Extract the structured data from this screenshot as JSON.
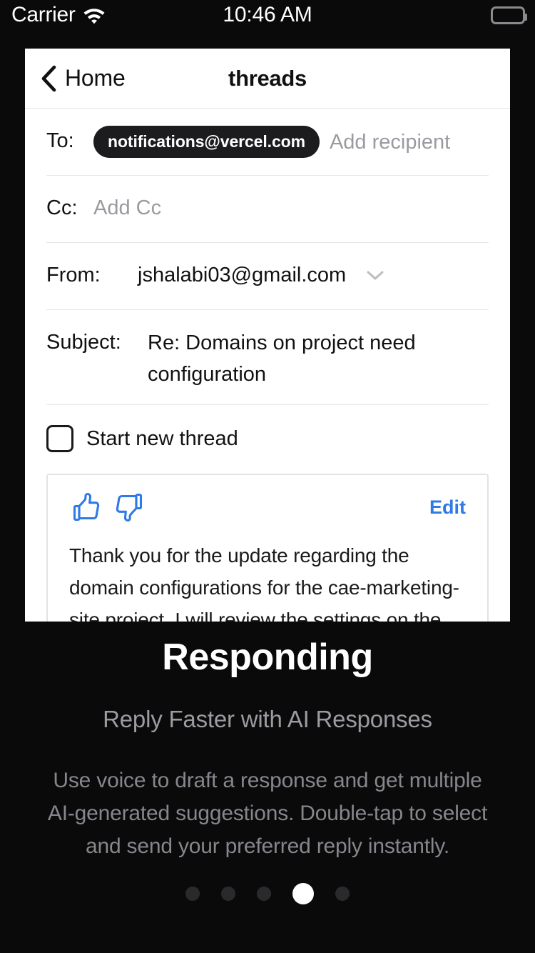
{
  "status_bar": {
    "carrier": "Carrier",
    "wifi_icon": "wifi-icon",
    "time": "10:46 AM",
    "battery_icon": "battery-full-icon"
  },
  "preview": {
    "nav": {
      "back_icon": "chevron-left-icon",
      "back_label": "Home",
      "title": "threads"
    },
    "compose": {
      "to": {
        "label": "To:",
        "chips": [
          "notifications@vercel.com"
        ],
        "placeholder": "Add recipient"
      },
      "cc": {
        "label": "Cc:",
        "placeholder": "Add Cc"
      },
      "from": {
        "label": "From:",
        "value": "jshalabi03@gmail.com",
        "dropdown_icon": "chevron-down-icon"
      },
      "subject": {
        "label": "Subject:",
        "value": "Re: Domains on project need configuration"
      },
      "start_new_thread": {
        "label": "Start new thread",
        "checked": false
      }
    },
    "suggestion": {
      "thumbs_up_icon": "thumbs-up-icon",
      "thumbs_down_icon": "thumbs-down-icon",
      "edit_label": "Edit",
      "body": "Thank you for the update regarding the domain configurations for the cae-marketing-site project. I will review the settings on the Vercel"
    }
  },
  "onboarding": {
    "title": "Responding",
    "subtitle": "Reply Faster with AI Responses",
    "description": "Use voice to draft a response and get multiple AI-generated suggestions. Double-tap to select and send your preferred reply instantly."
  },
  "pagination": {
    "total": 5,
    "active_index": 3
  },
  "colors": {
    "background": "#0A0A0B",
    "panel": "#FFFFFF",
    "accent_blue": "#2E7AE6",
    "chip_dark": "#1C1C1E",
    "muted_text": "#86868C"
  }
}
